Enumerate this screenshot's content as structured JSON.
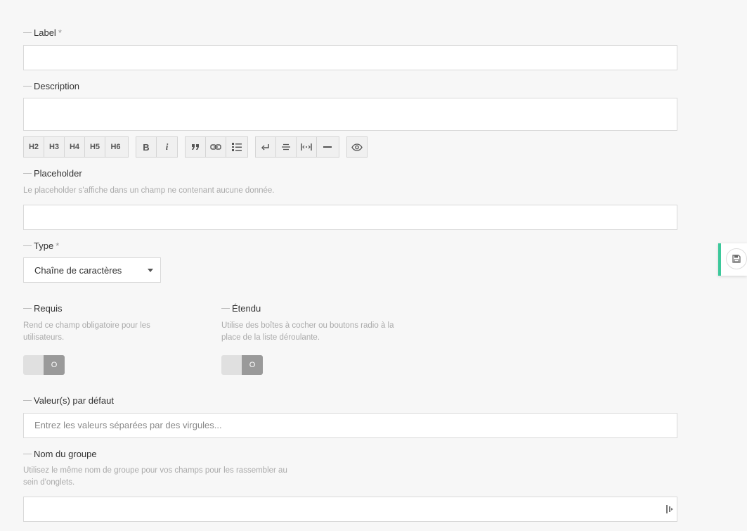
{
  "fields": {
    "label": {
      "title": "Label",
      "required_mark": "*",
      "value": ""
    },
    "description": {
      "title": "Description",
      "value": ""
    },
    "editor_toolbar": {
      "headings": [
        "H2",
        "H3",
        "H4",
        "H5",
        "H6"
      ],
      "format": [
        "B",
        "i"
      ],
      "insert_icons": [
        "quote-icon",
        "link-icon",
        "list-icon"
      ],
      "layout_icons": [
        "line-break-icon",
        "strikethrough-icon",
        "spacing-icon",
        "horizontal-rule-icon"
      ],
      "preview_icon": "eye-icon"
    },
    "placeholder": {
      "title": "Placeholder",
      "help": "Le placeholder s'affiche dans un champ ne contenant aucune donnée.",
      "value": ""
    },
    "type": {
      "title": "Type",
      "required_mark": "*",
      "selected": "Chaîne de caractères"
    },
    "requis": {
      "title": "Requis",
      "help": "Rend ce champ obligatoire pour les utilisateurs.",
      "toggle_label": "O",
      "on": false
    },
    "etendu": {
      "title": "Étendu",
      "help": "Utilise des boîtes à cocher ou boutons radio à la place de la liste déroulante.",
      "toggle_label": "O",
      "on": false
    },
    "defaults": {
      "title": "Valeur(s) par défaut",
      "placeholder": "Entrez les valeurs séparées par des virgules..."
    },
    "group": {
      "title": "Nom du groupe",
      "help": "Utilisez le même nom de groupe pour vos champs pour les rassembler au sein d'onglets.",
      "value": ""
    }
  },
  "save_tab": {
    "icon": "save-icon",
    "accent": "#3cc89b"
  }
}
